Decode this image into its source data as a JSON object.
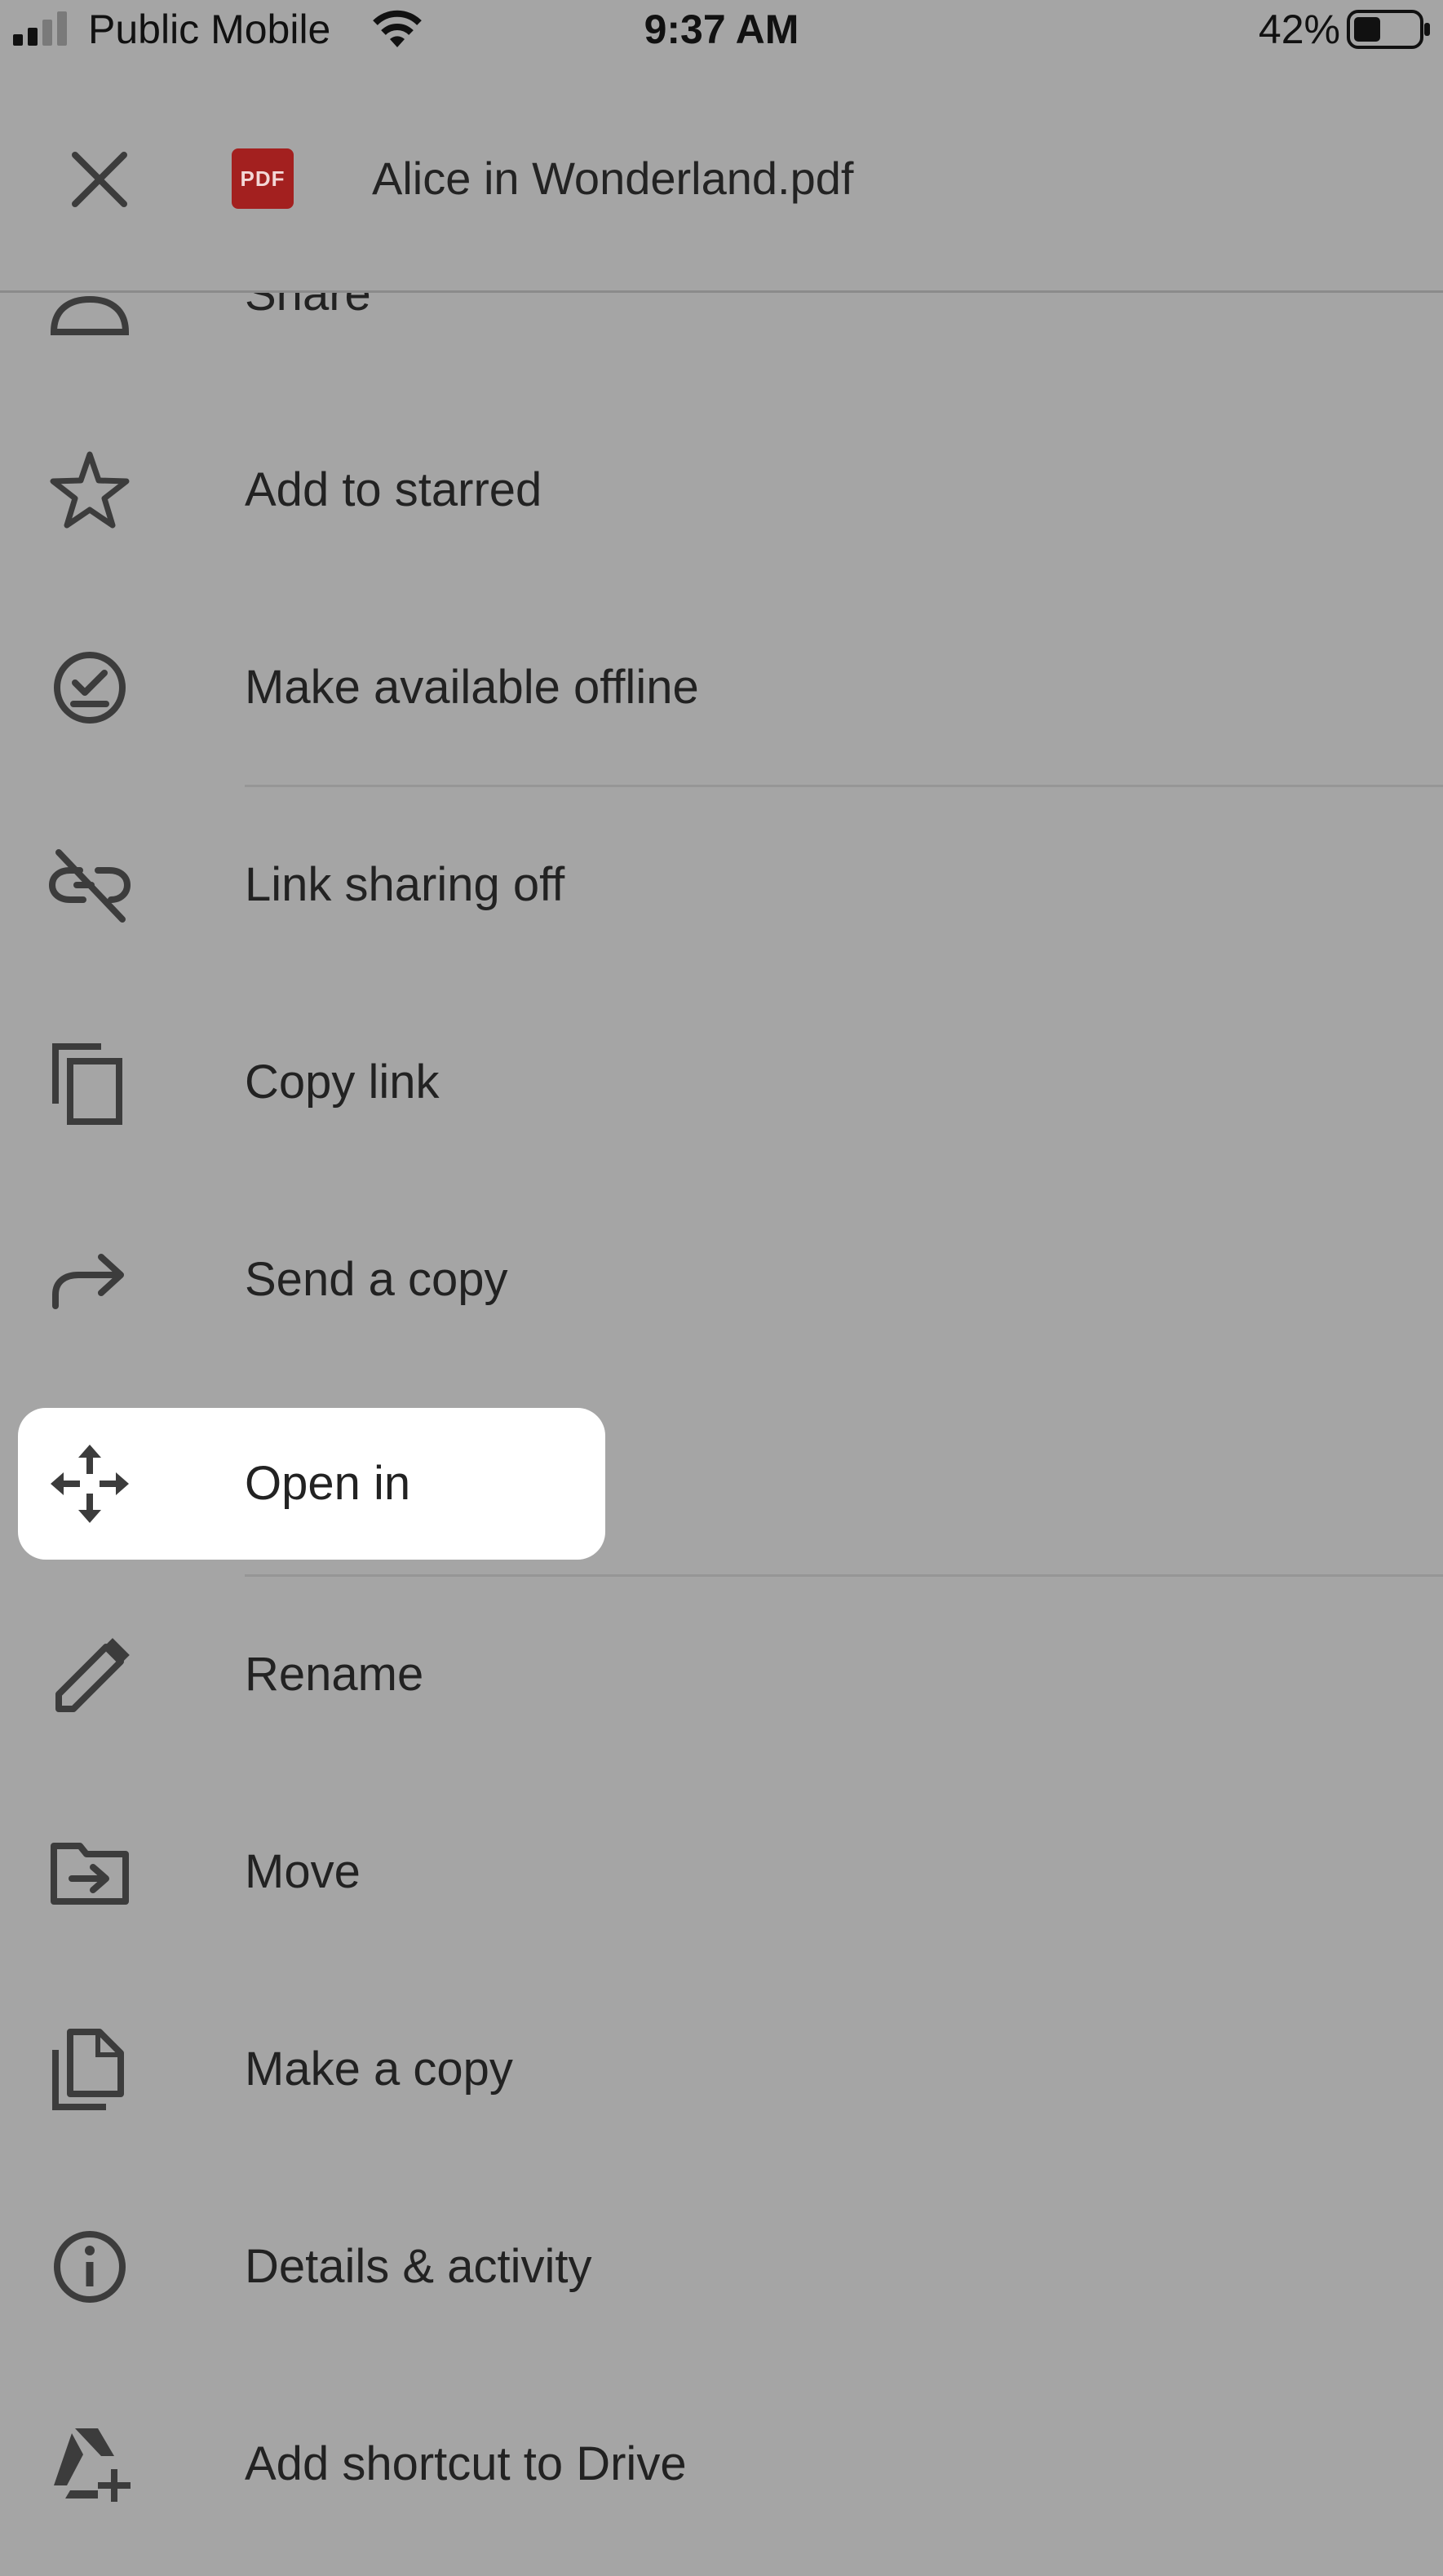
{
  "status_bar": {
    "carrier": "Public Mobile",
    "time": "9:37 AM",
    "battery_percent": "42%",
    "battery_level": 0.42,
    "signal_icon": "cellular-signal-icon",
    "wifi_icon": "wifi-icon",
    "battery_icon": "battery-icon"
  },
  "header": {
    "close_icon": "close-icon",
    "file_type_badge": "PDF",
    "file_title": "Alice in Wonderland.pdf"
  },
  "menu": {
    "items": [
      {
        "label": "Share",
        "icon": "share-person-icon"
      },
      {
        "label": "Add to starred",
        "icon": "star-icon"
      },
      {
        "label": "Make available offline",
        "icon": "offline-check-icon"
      },
      {
        "label": "Link sharing off",
        "icon": "link-off-icon"
      },
      {
        "label": "Copy link",
        "icon": "copy-icon"
      },
      {
        "label": "Send a copy",
        "icon": "forward-arrow-icon"
      },
      {
        "label": "Open in",
        "icon": "move-arrows-icon",
        "highlighted": true
      },
      {
        "label": "Rename",
        "icon": "pencil-icon"
      },
      {
        "label": "Move",
        "icon": "folder-move-icon"
      },
      {
        "label": "Make a copy",
        "icon": "file-copy-icon"
      },
      {
        "label": "Details & activity",
        "icon": "info-icon"
      },
      {
        "label": "Add shortcut to Drive",
        "icon": "drive-shortcut-icon"
      }
    ]
  },
  "colors": {
    "background_dim": "#a5a5a5",
    "highlight": "#ffffff",
    "pdf_badge": "#a3201f",
    "icon": "#3c3c3c"
  }
}
